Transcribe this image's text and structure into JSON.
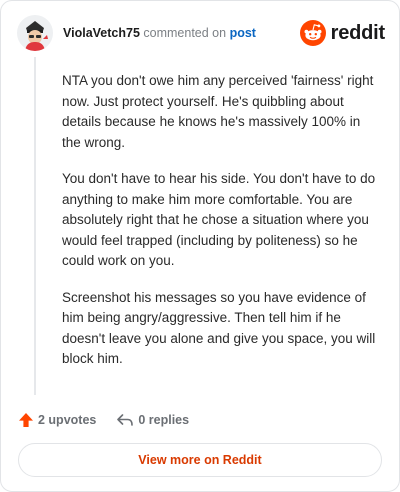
{
  "header": {
    "username": "ViolaVetch75",
    "action_text": "commented on",
    "post_link": "post",
    "brand_name": "reddit"
  },
  "comment": {
    "paragraphs": [
      "NTA you don't owe him any perceived 'fairness' right now. Just protect yourself. He's quibbling about details because he knows he's massively 100% in the wrong.",
      "You don't have to hear his side. You don't have to do anything to make him more comfortable. You are absolutely right that he chose a situation where you would feel trapped (including by politeness) so he could work on you.",
      "Screenshot his messages so you have evidence of him being angry/aggressive. Then tell him if he doesn't leave you alone and give you space, you will block him."
    ]
  },
  "actions": {
    "upvotes_label": "2 upvotes",
    "replies_label": "0 replies"
  },
  "footer": {
    "view_more_label": "View more on Reddit"
  },
  "icons": {
    "avatar": "user-avatar",
    "brand_logo": "reddit-logo-icon",
    "upvote": "upvote-arrow-icon",
    "reply": "reply-arrow-icon"
  },
  "colors": {
    "brand": "#ff4500",
    "upvote": "#ff4500",
    "link": "#0a66c2",
    "view_more_text": "#d93a00",
    "thread_line": "#e6e8eb"
  }
}
